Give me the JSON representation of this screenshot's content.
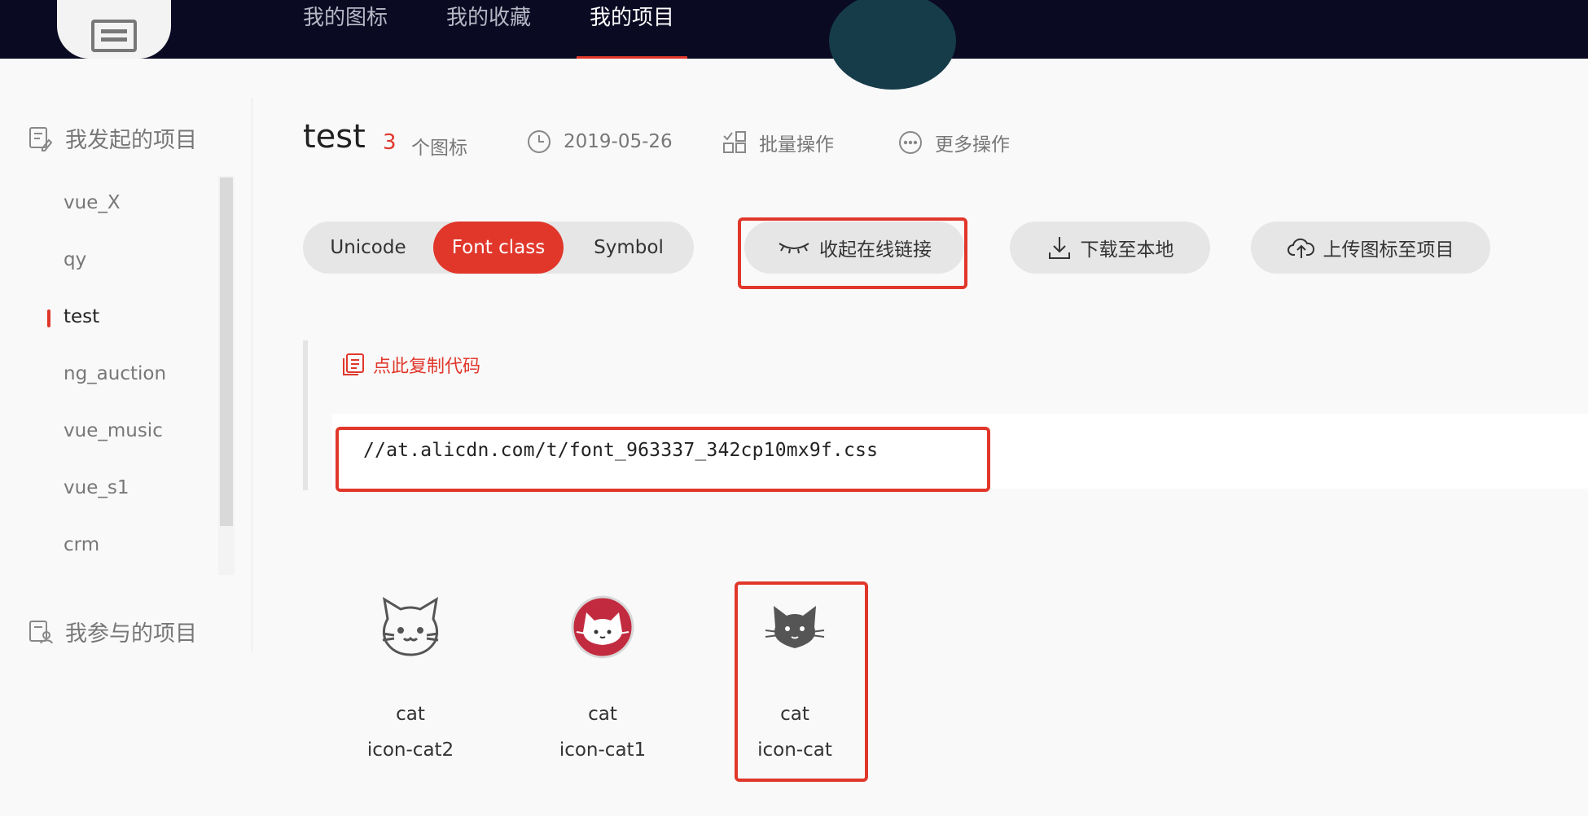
{
  "topnav": {
    "items": [
      {
        "label": "我的图标",
        "active": false
      },
      {
        "label": "我的收藏",
        "active": false
      },
      {
        "label": "我的项目",
        "active": true
      }
    ]
  },
  "sidebar": {
    "my_projects_heading": "我发起的项目",
    "joined_projects_heading": "我参与的项目",
    "projects": [
      {
        "label": "vue_X",
        "active": false
      },
      {
        "label": "qy",
        "active": false
      },
      {
        "label": "test",
        "active": true
      },
      {
        "label": "ng_auction",
        "active": false
      },
      {
        "label": "vue_music",
        "active": false
      },
      {
        "label": "vue_s1",
        "active": false
      },
      {
        "label": "crm",
        "active": false
      }
    ]
  },
  "project": {
    "title": "test",
    "icon_count": "3",
    "icon_count_label": "个图标",
    "date": "2019-05-26",
    "batch_label": "批量操作",
    "more_label": "更多操作"
  },
  "tabs": {
    "items": [
      {
        "label": "Unicode",
        "active": false
      },
      {
        "label": "Font class",
        "active": true
      },
      {
        "label": "Symbol",
        "active": false
      }
    ]
  },
  "actions": {
    "collapse_link": "收起在线链接",
    "download": "下载至本地",
    "upload": "上传图标至项目"
  },
  "code": {
    "copy_label": "点此复制代码",
    "url": "//at.alicdn.com/t/font_963337_342cp10mx9f.css"
  },
  "icons": [
    {
      "name": "cat",
      "code": "icon-cat2",
      "icon": "cat-outline-icon"
    },
    {
      "name": "cat",
      "code": "icon-cat1",
      "icon": "cat-red-circle-icon"
    },
    {
      "name": "cat",
      "code": "icon-cat",
      "icon": "cat-solid-icon"
    }
  ],
  "colors": {
    "accent": "#e1372b",
    "nav_bg": "#0a0a23",
    "pill_bg": "#e6e6e6"
  }
}
